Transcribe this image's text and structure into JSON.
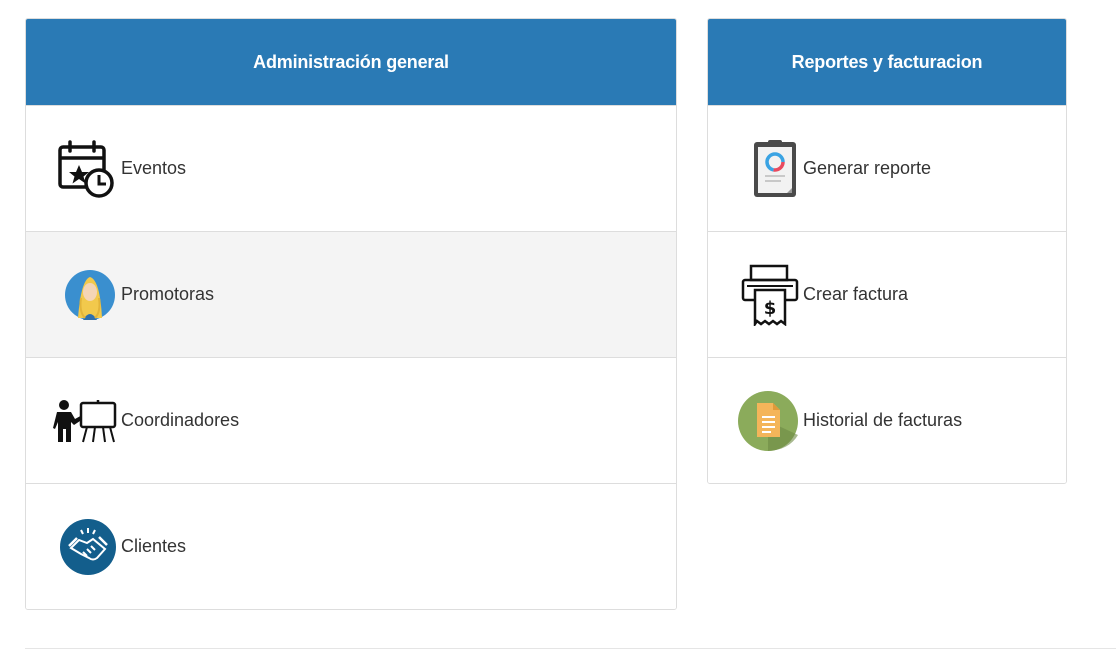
{
  "admin": {
    "title": "Administración general",
    "items": [
      {
        "label": "Eventos",
        "icon": "calendar-clock-icon"
      },
      {
        "label": "Promotoras",
        "icon": "promoter-avatar-icon"
      },
      {
        "label": "Coordinadores",
        "icon": "presenter-board-icon"
      },
      {
        "label": "Clientes",
        "icon": "handshake-icon"
      }
    ]
  },
  "reports": {
    "title": "Reportes y facturacion",
    "items": [
      {
        "label": "Generar reporte",
        "icon": "clipboard-report-icon"
      },
      {
        "label": "Crear factura",
        "icon": "invoice-printer-icon"
      },
      {
        "label": "Historial de facturas",
        "icon": "document-history-icon"
      }
    ]
  },
  "colors": {
    "header_bg": "#2a7ab5",
    "active_row_bg": "#f4f4f4",
    "handshake_bg": "#135e8c",
    "history_bg": "#8bab5b"
  }
}
